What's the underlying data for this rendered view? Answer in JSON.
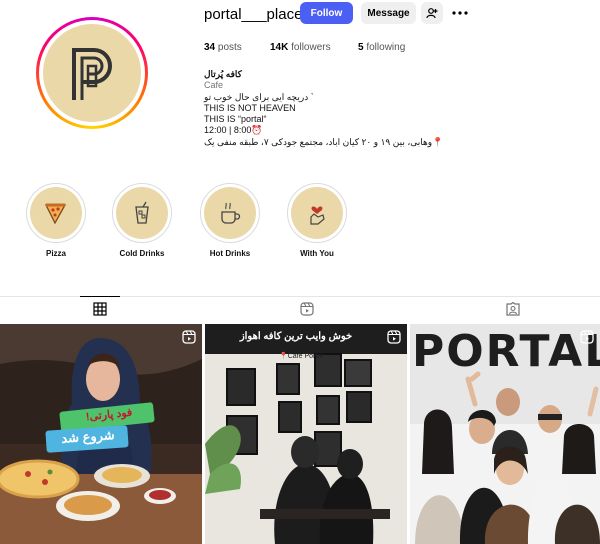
{
  "profile": {
    "username": "portal___place",
    "follow_label": "Follow",
    "message_label": "Message",
    "stats": {
      "posts": "34",
      "posts_label": "posts",
      "followers": "14K",
      "followers_label": "followers",
      "following": "5",
      "following_label": "following"
    },
    "display_name": "کافه پُرتال",
    "category": "Cafe",
    "bio_lines": [
      "` دریچه ایی برای حال خوب تو",
      "THIS IS NOT HEAVEN",
      "THIS IS “portal“",
      "12:00 | 8:00⏰",
      "📍وهابی، بین ۱۹ و ۲۰ کیان اباد، مجتمع جودکی ۷، طبقه منفی یک"
    ]
  },
  "highlights": [
    {
      "label": "Pizza",
      "icon": "pizza-icon"
    },
    {
      "label": "Cold Drinks",
      "icon": "cold-drink-icon"
    },
    {
      "label": "Hot Drinks",
      "icon": "coffee-cup-icon"
    },
    {
      "label": "With You",
      "icon": "heart-hand-icon"
    }
  ],
  "tabs": [
    {
      "name": "posts",
      "icon": "grid-icon",
      "active": true
    },
    {
      "name": "reels",
      "icon": "reels-icon",
      "active": false
    },
    {
      "name": "tagged",
      "icon": "tagged-icon",
      "active": false
    }
  ],
  "posts": [
    {
      "overlay_top": "فود پارتی!",
      "overlay_bottom": "شروع شد",
      "type": "reel"
    },
    {
      "overlay_top": "خوش وایب ترین کافه اهواز",
      "location": "📍Cafe Portal",
      "type": "reel"
    },
    {
      "overlay_top": "PORTAL",
      "type": "reel"
    }
  ],
  "colors": {
    "accent": "#4c5ff5",
    "brand_beige": "#ead8a8"
  }
}
